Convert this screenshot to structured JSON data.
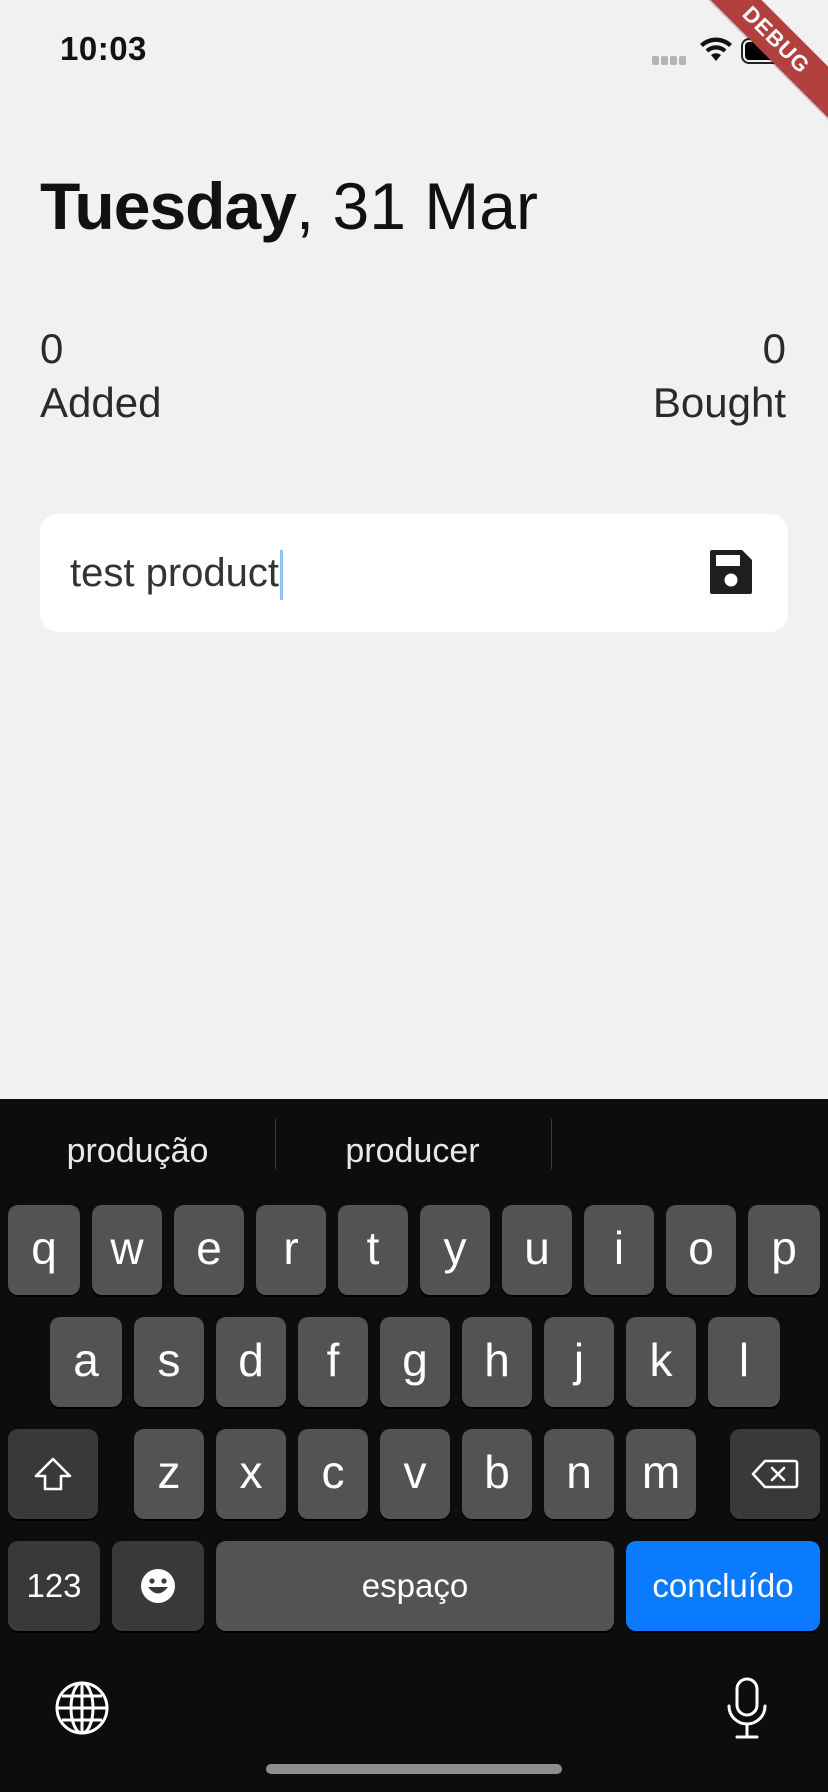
{
  "status_bar": {
    "time": "10:03",
    "icons": [
      "signal-icon",
      "wifi-icon",
      "battery-icon"
    ]
  },
  "debug_banner": "DEBUG",
  "header": {
    "day": "Tuesday",
    "date_rest": ", 31 Mar"
  },
  "stats": {
    "added_count": "0",
    "added_label": "Added",
    "bought_count": "0",
    "bought_label": "Bought"
  },
  "product_input": {
    "value": "test product",
    "save_icon": "floppy-disk-save-icon"
  },
  "keyboard": {
    "suggestions": [
      "produção",
      "producer"
    ],
    "row1": [
      "q",
      "w",
      "e",
      "r",
      "t",
      "y",
      "u",
      "i",
      "o",
      "p"
    ],
    "row2": [
      "a",
      "s",
      "d",
      "f",
      "g",
      "h",
      "j",
      "k",
      "l"
    ],
    "row3": [
      "z",
      "x",
      "c",
      "v",
      "b",
      "n",
      "m"
    ],
    "numbers_key": "123",
    "space_key": "espaço",
    "done_key": "concluído",
    "accent_color": "#0a7afe"
  }
}
